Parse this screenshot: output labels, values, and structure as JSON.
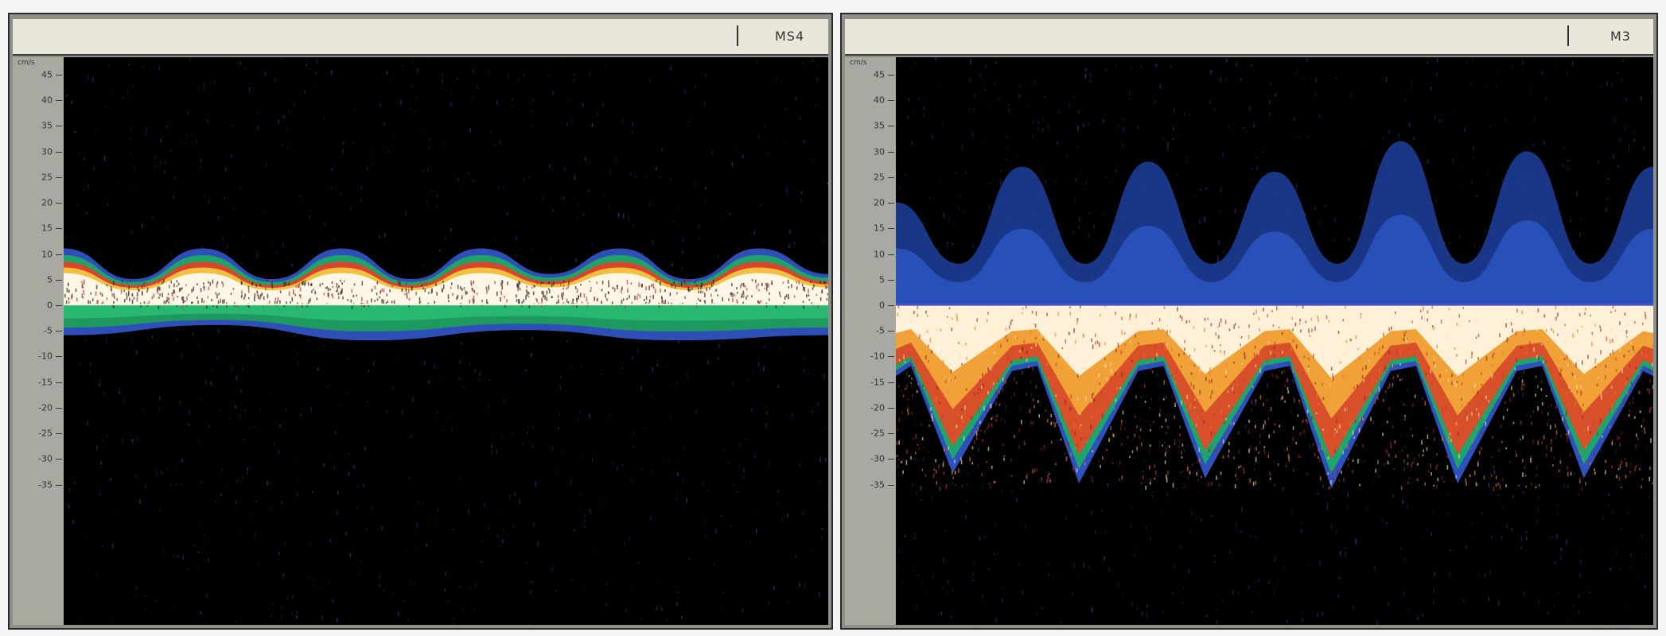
{
  "panels": [
    {
      "id": "left",
      "title_label": "MS4",
      "unit": "cm/s",
      "ticks": [
        "45",
        "40",
        "35",
        "30",
        "25",
        "20",
        "15",
        "10",
        "5",
        "0",
        "-5",
        "-10",
        "-15",
        "-20",
        "-25",
        "-30",
        "-35"
      ],
      "tick_values": [
        45,
        40,
        35,
        30,
        25,
        20,
        15,
        10,
        5,
        0,
        -5,
        -10,
        -15,
        -20,
        -25,
        -30,
        -35
      ],
      "cycles": 6,
      "pos_envelope": [
        11,
        5,
        11,
        5,
        11,
        5,
        11,
        6,
        11,
        5,
        11,
        6
      ],
      "neg_envelope": [
        -6,
        -4,
        -7,
        -5,
        -7,
        -6
      ]
    },
    {
      "id": "right",
      "title_label": "M3",
      "unit": "cm/s",
      "ticks": [
        "45",
        "40",
        "35",
        "30",
        "25",
        "20",
        "15",
        "10",
        "5",
        "0",
        "-5",
        "-10",
        "-15",
        "-20",
        "-25",
        "-30",
        "-35"
      ],
      "tick_values": [
        45,
        40,
        35,
        30,
        25,
        20,
        15,
        10,
        5,
        0,
        -5,
        -10,
        -15,
        -20,
        -25,
        -30,
        -35
      ],
      "cycles": 6,
      "pos_peaks": [
        20,
        27,
        28,
        26,
        32,
        30,
        27
      ],
      "neg_peaks": [
        -33,
        -35,
        -34,
        -36,
        -35,
        -34
      ]
    }
  ],
  "colors": {
    "background": "#000000",
    "axis_strip": "#a9a9a2",
    "titlebar": "#e9e6dc",
    "baseline": "#3f4fb0"
  }
}
